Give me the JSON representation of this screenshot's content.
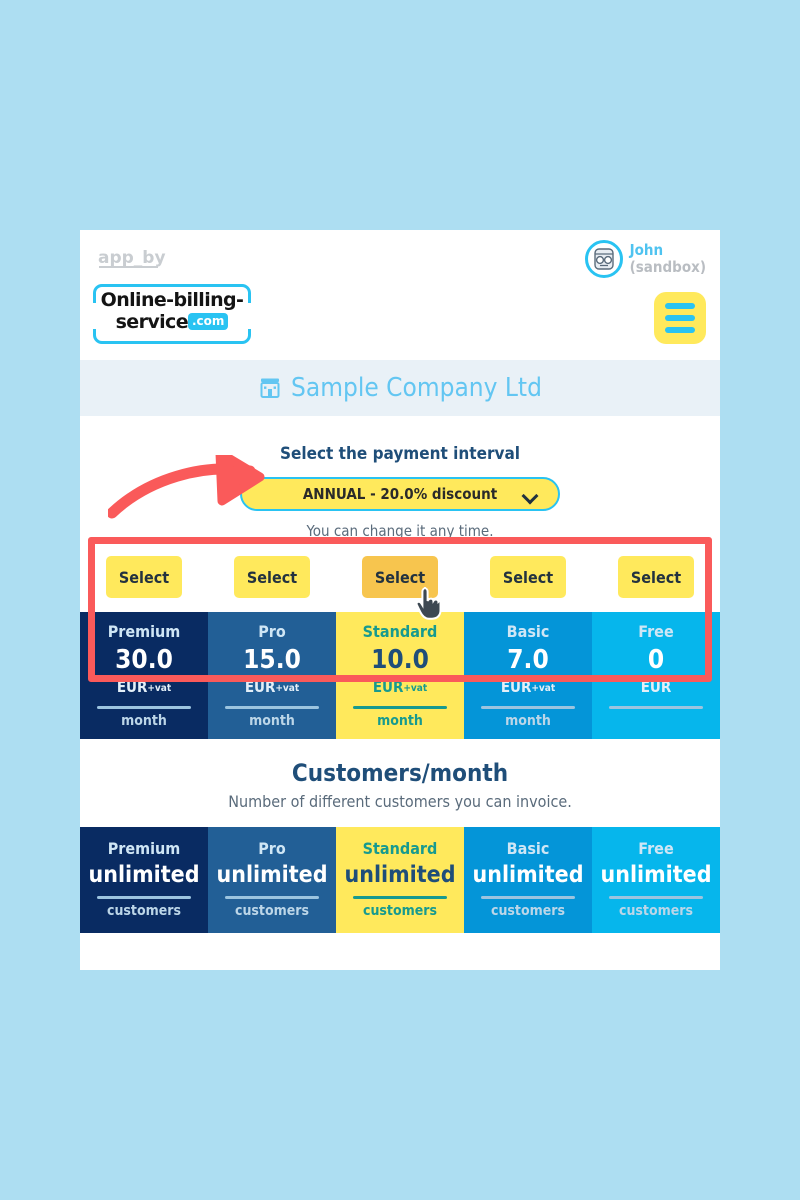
{
  "header": {
    "app_by_text": "app_by",
    "logo_line1": "Online-billing-",
    "logo_line2": "service",
    "logo_badge": ".com",
    "user_name": "John",
    "user_env": "(sandbox)",
    "menu_icon": "hamburger-menu-icon",
    "avatar_icon": "user-avatar-icon"
  },
  "company": {
    "icon": "building-icon",
    "name": "Sample Company Ltd"
  },
  "interval": {
    "label": "Select the payment interval",
    "selected": "ANNUAL - 20.0% discount",
    "chevron_icon": "chevron-down-icon",
    "note": "You can change it any time."
  },
  "actions": {
    "select_label": "Select",
    "buttons": [
      {
        "label": "Select",
        "state": "normal"
      },
      {
        "label": "Select",
        "state": "normal"
      },
      {
        "label": "Select",
        "state": "hovered"
      },
      {
        "label": "Select",
        "state": "normal"
      },
      {
        "label": "Select",
        "state": "normal"
      }
    ]
  },
  "plans": [
    {
      "name": "Premium",
      "price": "30.0",
      "currency": "EUR",
      "vat": "+vat",
      "period": "month",
      "color": "#092B62"
    },
    {
      "name": "Pro",
      "price": "15.0",
      "currency": "EUR",
      "vat": "+vat",
      "period": "month",
      "color": "#225F96"
    },
    {
      "name": "Standard",
      "price": "10.0",
      "currency": "EUR",
      "vat": "+vat",
      "period": "month",
      "color": "#FFE95C"
    },
    {
      "name": "Basic",
      "price": "7.0",
      "currency": "EUR",
      "vat": "+vat",
      "period": "month",
      "color": "#0495D8"
    },
    {
      "name": "Free",
      "price": "0",
      "currency": "EUR",
      "vat": "",
      "period": "",
      "color": "#06B6EC"
    }
  ],
  "feature": {
    "title": "Customers/month",
    "subtitle": "Number of different customers you can invoice.",
    "rows": [
      {
        "name": "Premium",
        "value": "unlimited",
        "unit": "customers"
      },
      {
        "name": "Pro",
        "value": "unlimited",
        "unit": "customers"
      },
      {
        "name": "Standard",
        "value": "unlimited",
        "unit": "customers"
      },
      {
        "name": "Basic",
        "value": "unlimited",
        "unit": "customers"
      },
      {
        "name": "Free",
        "value": "unlimited",
        "unit": "customers"
      }
    ]
  },
  "annotations": {
    "arrow_color": "#FA5A5A",
    "box_color": "#FA5A5A",
    "cursor_icon": "pointer-hand-cursor"
  },
  "theme": {
    "page_background": "#ADDEF2",
    "accent_yellow": "#FFE95C",
    "accent_blue": "#29C3F2",
    "dark_blue": "#1F4E79"
  }
}
